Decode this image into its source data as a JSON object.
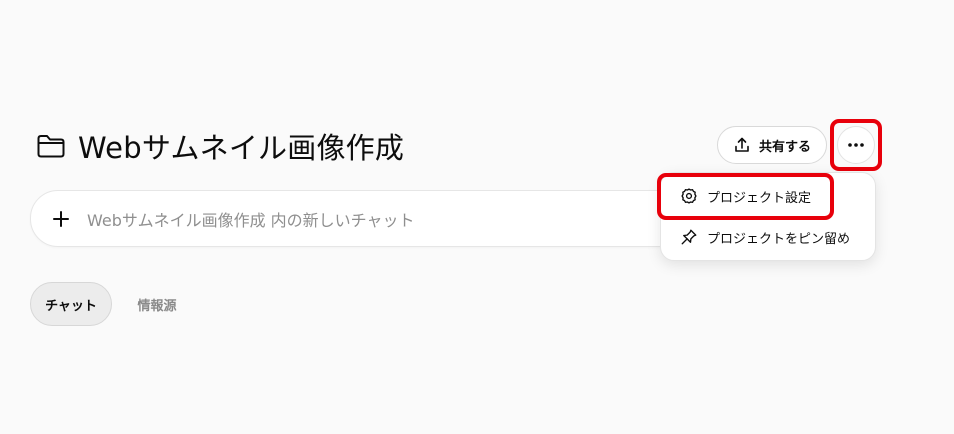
{
  "header": {
    "title": "Webサムネイル画像作成",
    "folder_icon": "folder-icon"
  },
  "toolbar": {
    "share_label": "共有する",
    "share_icon": "share-upload-icon",
    "more_icon": "ellipsis-icon"
  },
  "chat": {
    "placeholder": "Webサムネイル画像作成 内の新しいチャット",
    "plus_icon": "plus-icon"
  },
  "tabs": [
    {
      "label": "チャット",
      "active": true
    },
    {
      "label": "情報源",
      "active": false
    }
  ],
  "menu": {
    "items": [
      {
        "label": "プロジェクト設定",
        "icon": "gear-icon"
      },
      {
        "label": "プロジェクトをピン留め",
        "icon": "pin-icon"
      }
    ]
  },
  "colors": {
    "background": "#fafafa",
    "highlight": "#e8000b",
    "placeholder": "#8f8f8f",
    "inactive_tab": "#8a8a8a"
  }
}
